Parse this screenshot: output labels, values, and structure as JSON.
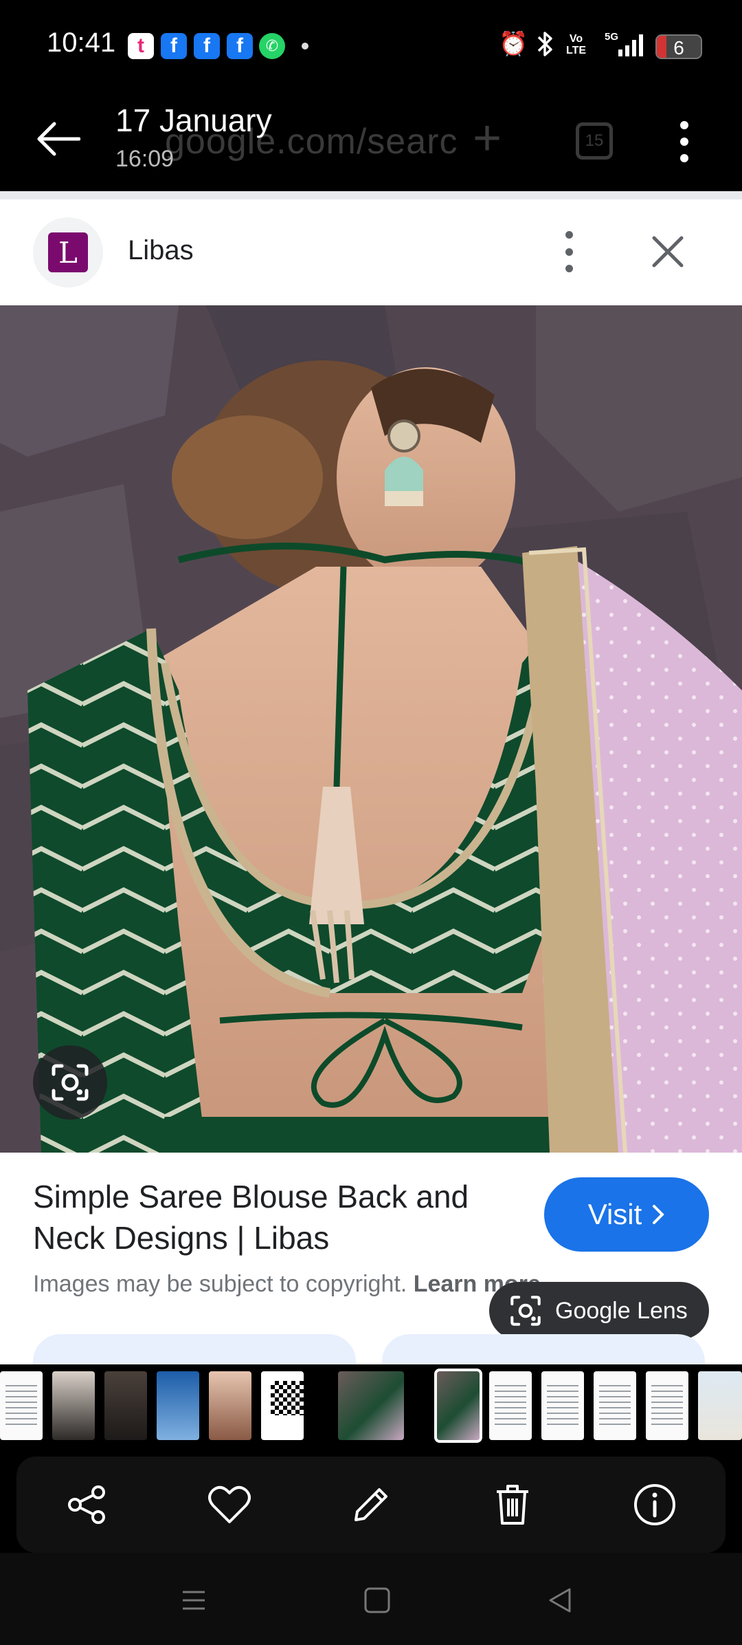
{
  "status_bar": {
    "time": "10:41",
    "notification_icons": [
      "tiktok-notification-icon",
      "facebook-notification-icon",
      "facebook-notification-icon",
      "facebook-notification-icon",
      "whatsapp-notification-icon"
    ],
    "network_label": "Vo\nLTE",
    "signal_label": "5G",
    "battery_level": "6",
    "battery_color": "#d23434"
  },
  "header": {
    "date": "17 January",
    "time": "16:09",
    "ghost_url": "google.com/searc",
    "ghost_tab_count": "15"
  },
  "source": {
    "favicon_letter": "L",
    "favicon_color": "#7a0a6e",
    "name": "Libas"
  },
  "result": {
    "title": "Simple Saree Blouse Back and Neck Designs | Libas",
    "visit_label": "Visit",
    "copyright_text": "Images may be subject to copyright.",
    "learn_more": "Learn more",
    "lens_label": "Google Lens",
    "accent_color": "#1a73e8"
  },
  "thumbnails": [
    {
      "kind": "doc"
    },
    {
      "kind": "photo-a"
    },
    {
      "kind": "photo-b"
    },
    {
      "kind": "photo-c"
    },
    {
      "kind": "photo-d"
    },
    {
      "kind": "qr"
    },
    {
      "kind": "green"
    },
    {
      "kind": "green",
      "selected": true
    },
    {
      "kind": "doc"
    },
    {
      "kind": "doc"
    },
    {
      "kind": "doc"
    },
    {
      "kind": "doc"
    },
    {
      "kind": "promo"
    }
  ],
  "toolbar": {
    "icons": [
      "share-icon",
      "heart-icon",
      "edit-icon",
      "delete-icon",
      "info-icon"
    ]
  },
  "nav_bar": {
    "icons": [
      "recents-icon",
      "home-icon",
      "back-icon"
    ]
  }
}
